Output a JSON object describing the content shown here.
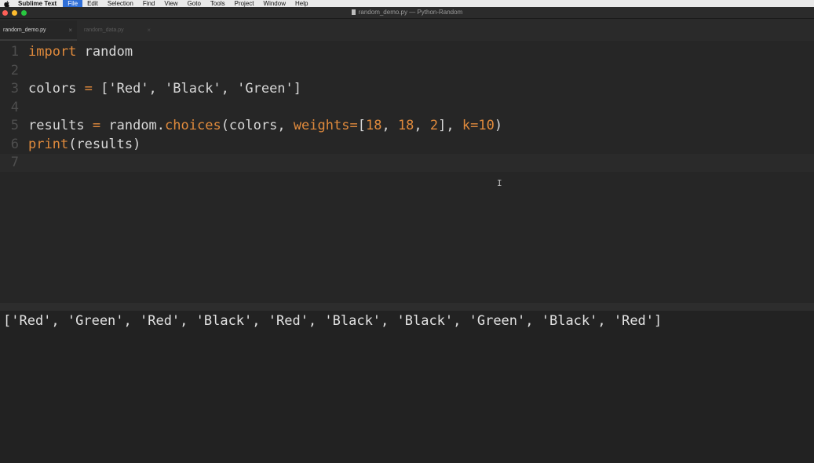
{
  "menubar": {
    "app_name": "Sublime Text",
    "items": [
      "File",
      "Edit",
      "Selection",
      "Find",
      "View",
      "Goto",
      "Tools",
      "Project",
      "Window",
      "Help"
    ],
    "active_item": "File"
  },
  "window": {
    "title": "random_demo.py — Python-Random",
    "traffic_lights": {
      "close": "#fe5f57",
      "minimize": "#febc2e",
      "zoom": "#28c840"
    }
  },
  "tabs": [
    {
      "label": "random_demo.py",
      "close": "×",
      "active": true
    },
    {
      "label": "random_data.py",
      "close": "×",
      "active": false
    }
  ],
  "editor": {
    "line_numbers": [
      "1",
      "2",
      "3",
      "4",
      "5",
      "6",
      "7"
    ],
    "lines": [
      [
        {
          "t": "import",
          "c": "kw"
        },
        {
          "t": " random",
          "c": "pl"
        }
      ],
      [],
      [
        {
          "t": "colors ",
          "c": "pl"
        },
        {
          "t": "=",
          "c": "kw"
        },
        {
          "t": " ['Red', 'Black', 'Green']",
          "c": "pl"
        }
      ],
      [],
      [
        {
          "t": "results ",
          "c": "pl"
        },
        {
          "t": "=",
          "c": "kw"
        },
        {
          "t": " random.",
          "c": "pl"
        },
        {
          "t": "choices",
          "c": "fn"
        },
        {
          "t": "(colors, ",
          "c": "pl"
        },
        {
          "t": "weights",
          "c": "kw"
        },
        {
          "t": "=",
          "c": "kw"
        },
        {
          "t": "[",
          "c": "pl"
        },
        {
          "t": "18",
          "c": "kw"
        },
        {
          "t": ", ",
          "c": "pl"
        },
        {
          "t": "18",
          "c": "kw"
        },
        {
          "t": ", ",
          "c": "pl"
        },
        {
          "t": "2",
          "c": "kw"
        },
        {
          "t": "], ",
          "c": "pl"
        },
        {
          "t": "k",
          "c": "kw"
        },
        {
          "t": "=",
          "c": "kw"
        },
        {
          "t": "10",
          "c": "kw"
        },
        {
          "t": ")",
          "c": "pl"
        }
      ],
      [
        {
          "t": "print",
          "c": "fn"
        },
        {
          "t": "(results)",
          "c": "pl"
        }
      ],
      []
    ],
    "current_line": 7,
    "cursor_glyph": "I"
  },
  "output": {
    "text": "['Red', 'Green', 'Red', 'Black', 'Red', 'Black', 'Black', 'Green', 'Black', 'Red']"
  },
  "colors": {
    "keyword": "#e08a3c",
    "text": "#d8d8d8",
    "background": "#262626"
  }
}
